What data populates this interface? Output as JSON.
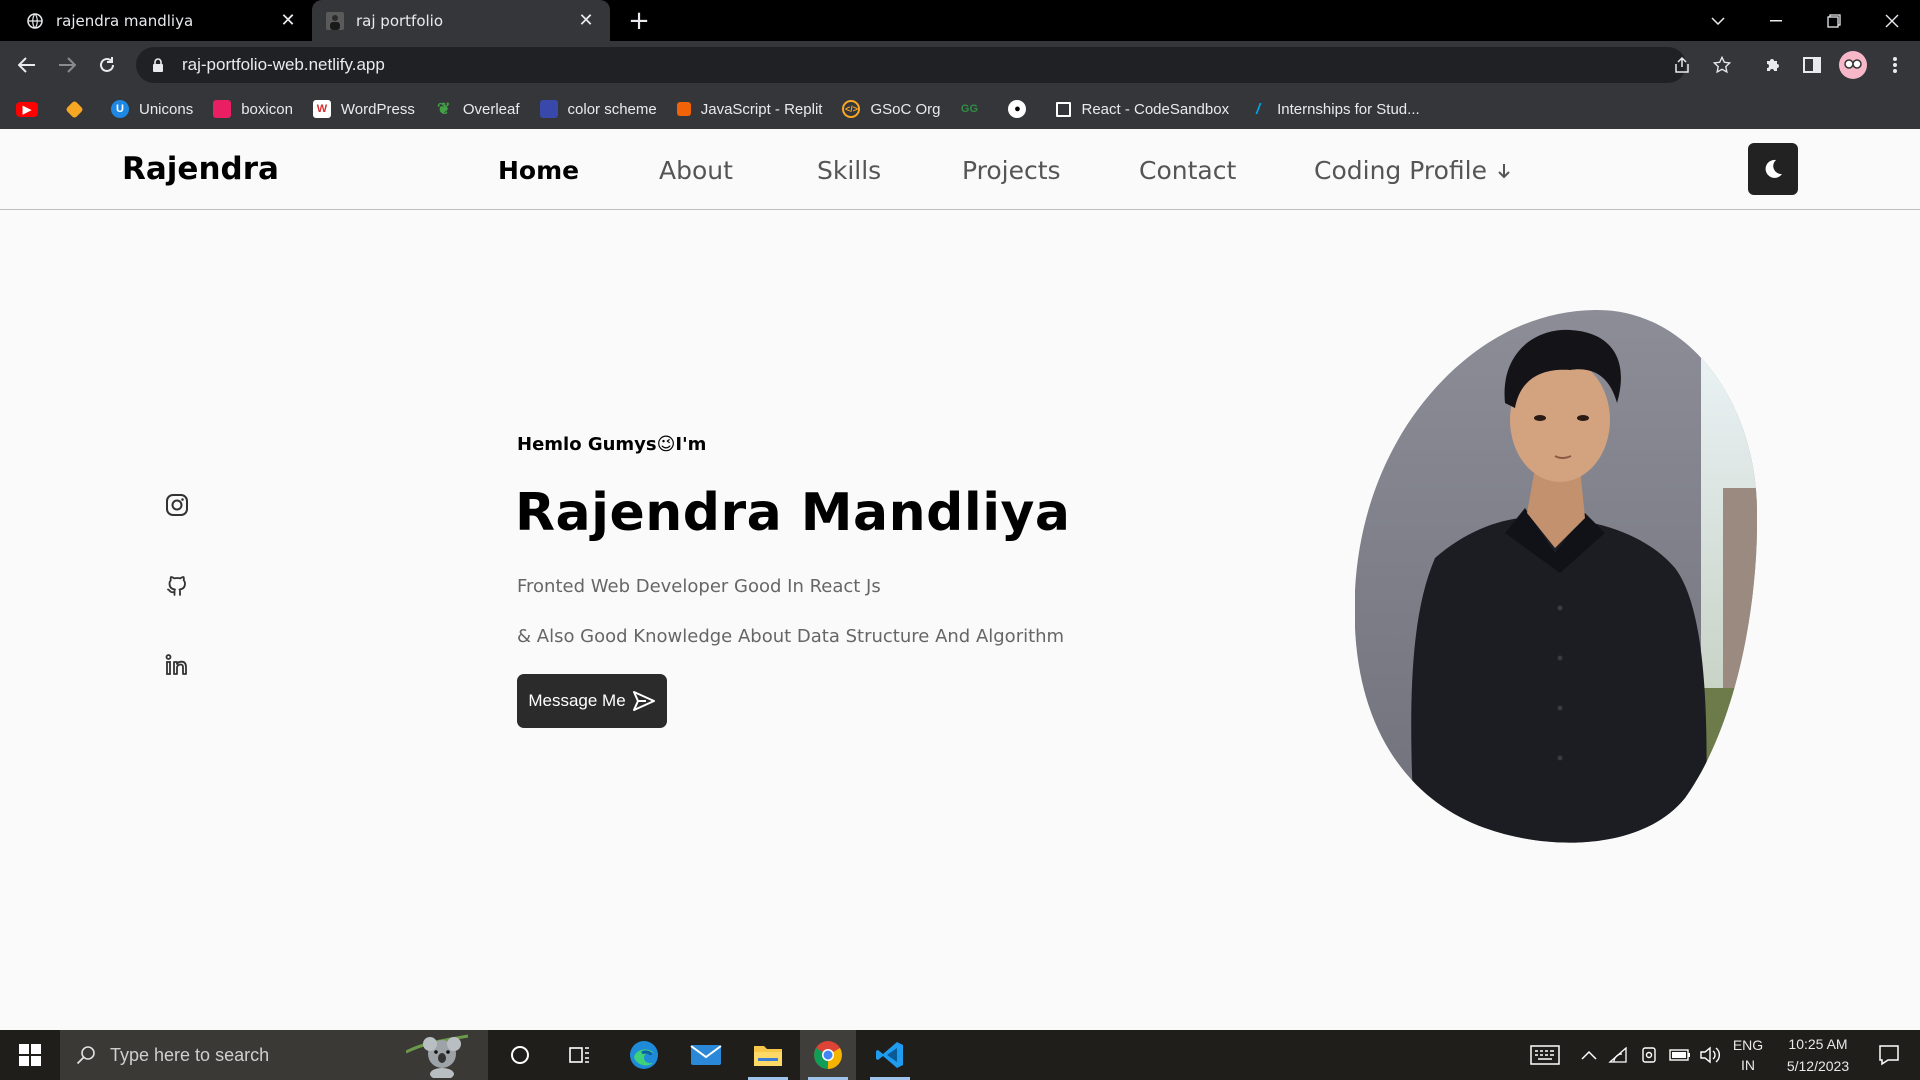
{
  "browser": {
    "tabs": [
      {
        "title": "rajendra mandliya",
        "active": false
      },
      {
        "title": "raj portfolio",
        "active": true
      }
    ],
    "url": "raj-portfolio-web.netlify.app",
    "bookmarks": [
      {
        "label": "",
        "icon": "youtube-icon",
        "color": "#ff0000"
      },
      {
        "label": "",
        "icon": "layers-icon",
        "color": "#f5a623"
      },
      {
        "label": "Unicons",
        "icon": "unicons-icon",
        "color": "#1e88e5"
      },
      {
        "label": "boxicon",
        "icon": "boxicon-icon",
        "color": "#e91e63"
      },
      {
        "label": "WordPress",
        "icon": "wordpress-icon",
        "color": "#d32f2f"
      },
      {
        "label": "Overleaf",
        "icon": "overleaf-icon",
        "color": "#43a047"
      },
      {
        "label": "color scheme",
        "icon": "color-scheme-icon",
        "color": "#3949ab"
      },
      {
        "label": "JavaScript - Replit",
        "icon": "replit-icon",
        "color": "#f26207"
      },
      {
        "label": "GSoC Org",
        "icon": "gsoc-icon",
        "color": "#f9a825"
      },
      {
        "label": "",
        "icon": "geeksforgeeks-icon",
        "color": "#2f8d46"
      },
      {
        "label": "",
        "icon": "github-icon",
        "color": "#ffffff"
      },
      {
        "label": "React - CodeSandbox",
        "icon": "codesandbox-icon",
        "color": "#ffffff"
      },
      {
        "label": "Internships for Stud...",
        "icon": "internshala-icon",
        "color": "#00a5ec"
      }
    ]
  },
  "site": {
    "brand": "Rajendra",
    "nav": {
      "home": "Home",
      "about": "About",
      "skills": "Skills",
      "projects": "Projects",
      "contact": "Contact",
      "coding_profile": "Coding Profile"
    },
    "hero": {
      "greeting": "Hemlo Gumys😉I'm",
      "name": "Rajendra Mandliya",
      "line1": "Fronted Web Developer Good In React Js",
      "line2": "& Also Good Knowledge About Data Structure And Algorithm",
      "button": "Message Me"
    },
    "social": [
      "instagram-icon",
      "github-icon",
      "linkedin-icon"
    ]
  },
  "taskbar": {
    "search_placeholder": "Type here to search",
    "lang_top": "ENG",
    "lang_bottom": "IN",
    "time": "10:25 AM",
    "date": "5/12/2023"
  }
}
